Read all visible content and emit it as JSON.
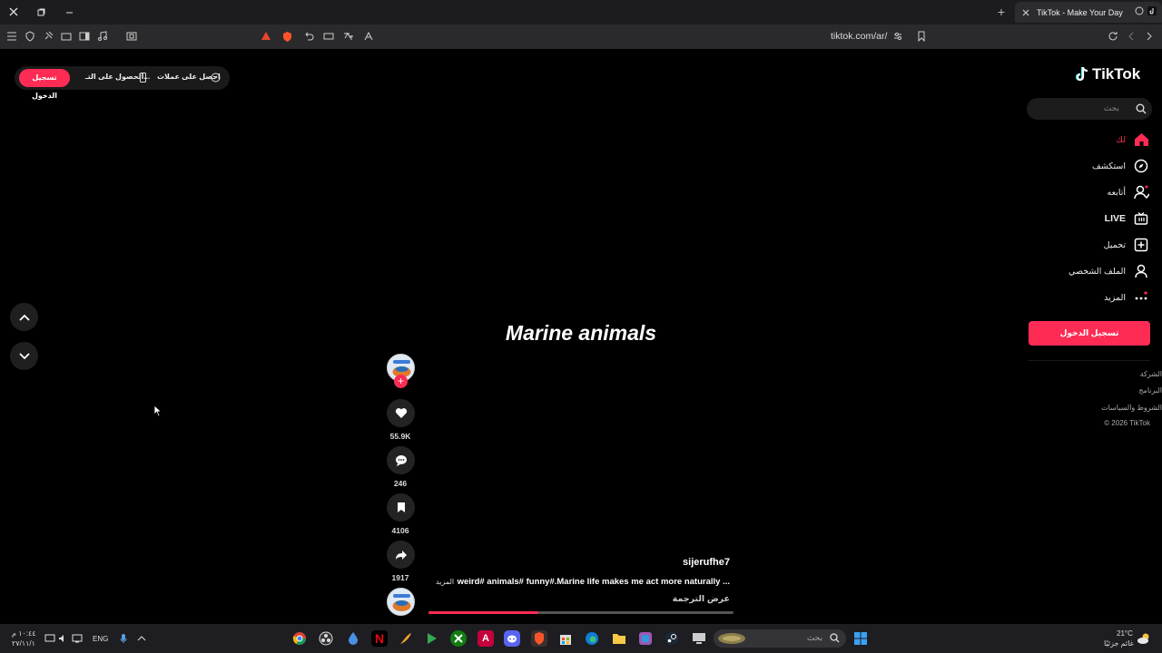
{
  "browser": {
    "tab_title": "TikTok - Make Your Day",
    "url": "tiktok.com/ar/",
    "new_tab": "+"
  },
  "topbar": {
    "login_label": "تسجيل الدخول",
    "get_app_label": "الحصول على التـ...",
    "get_coins_label": "احصل على عملات"
  },
  "video": {
    "title": "Marine animals",
    "username": "sijerufhe7",
    "description": "weird# animals# funny#.Marine life makes me act more naturally ...",
    "more_label": "المزيد",
    "translate_label": "عرض الترجمة",
    "progress_percent": 36
  },
  "actions": {
    "likes": "55.9K",
    "comments": "246",
    "saves": "4106",
    "shares": "1917",
    "follow_symbol": "+"
  },
  "sidebar": {
    "logo_text": "TikTok",
    "search_placeholder": "بحث",
    "items": [
      {
        "label": "لك",
        "icon": "home-icon",
        "active": true
      },
      {
        "label": "استكشف",
        "icon": "compass-icon"
      },
      {
        "label": "أتابعه",
        "icon": "following-icon"
      },
      {
        "label": "LIVE",
        "icon": "live-icon"
      },
      {
        "label": "تحميل",
        "icon": "upload-icon"
      },
      {
        "label": "الملف الشخصي",
        "icon": "profile-icon"
      },
      {
        "label": "المزيد",
        "icon": "more-icon"
      }
    ],
    "login_label": "تسجيل الدخول",
    "footer": [
      "الشركة",
      "البرنامج",
      "الشروط والسياسات",
      "© 2026 TikTok"
    ]
  },
  "taskbar": {
    "search_placeholder": "بحث",
    "language": "ENG",
    "time": "١٠:٤٤ م",
    "date": "٢٧/١١/١",
    "weather_temp": "21°C",
    "weather_desc": "غائم جزئيًا"
  },
  "colors": {
    "accent": "#fe2c55",
    "background": "#000000",
    "chrome": "#2a2a2d"
  }
}
